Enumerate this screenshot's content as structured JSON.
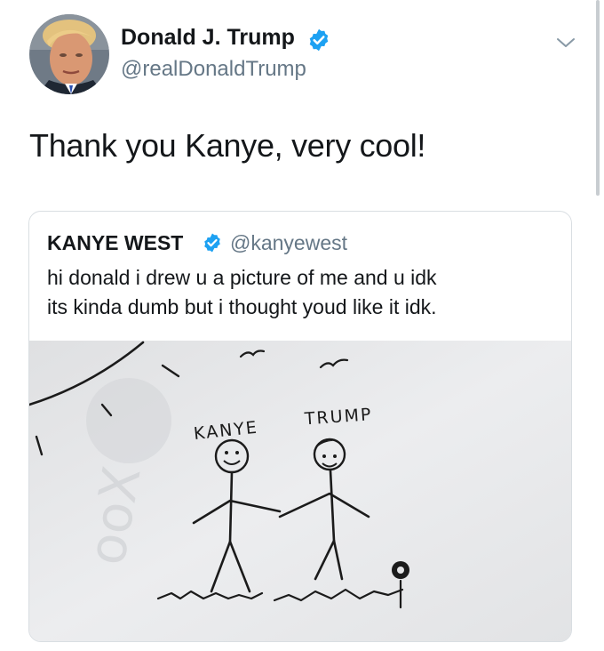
{
  "tweet": {
    "author": {
      "name": "Donald J. Trump",
      "handle": "@realDonaldTrump",
      "verified": true
    },
    "text": "Thank you Kanye, very cool!",
    "menu_icon": "chevron-down-icon",
    "quoted_tweet": {
      "author": {
        "name": "KANYE WEST",
        "handle": "@kanyewest",
        "verified": true
      },
      "text_lines": [
        "hi donald i drew u a picture of me and u idk",
        "its kinda dumb but i thought youd like it idk."
      ],
      "media": {
        "drawing_labels": [
          "KANYE",
          "TRUMP"
        ]
      }
    }
  },
  "colors": {
    "verified": "#1da1f2",
    "secondary_text": "#657786",
    "primary_text": "#14171a",
    "border": "#d9dee2"
  }
}
